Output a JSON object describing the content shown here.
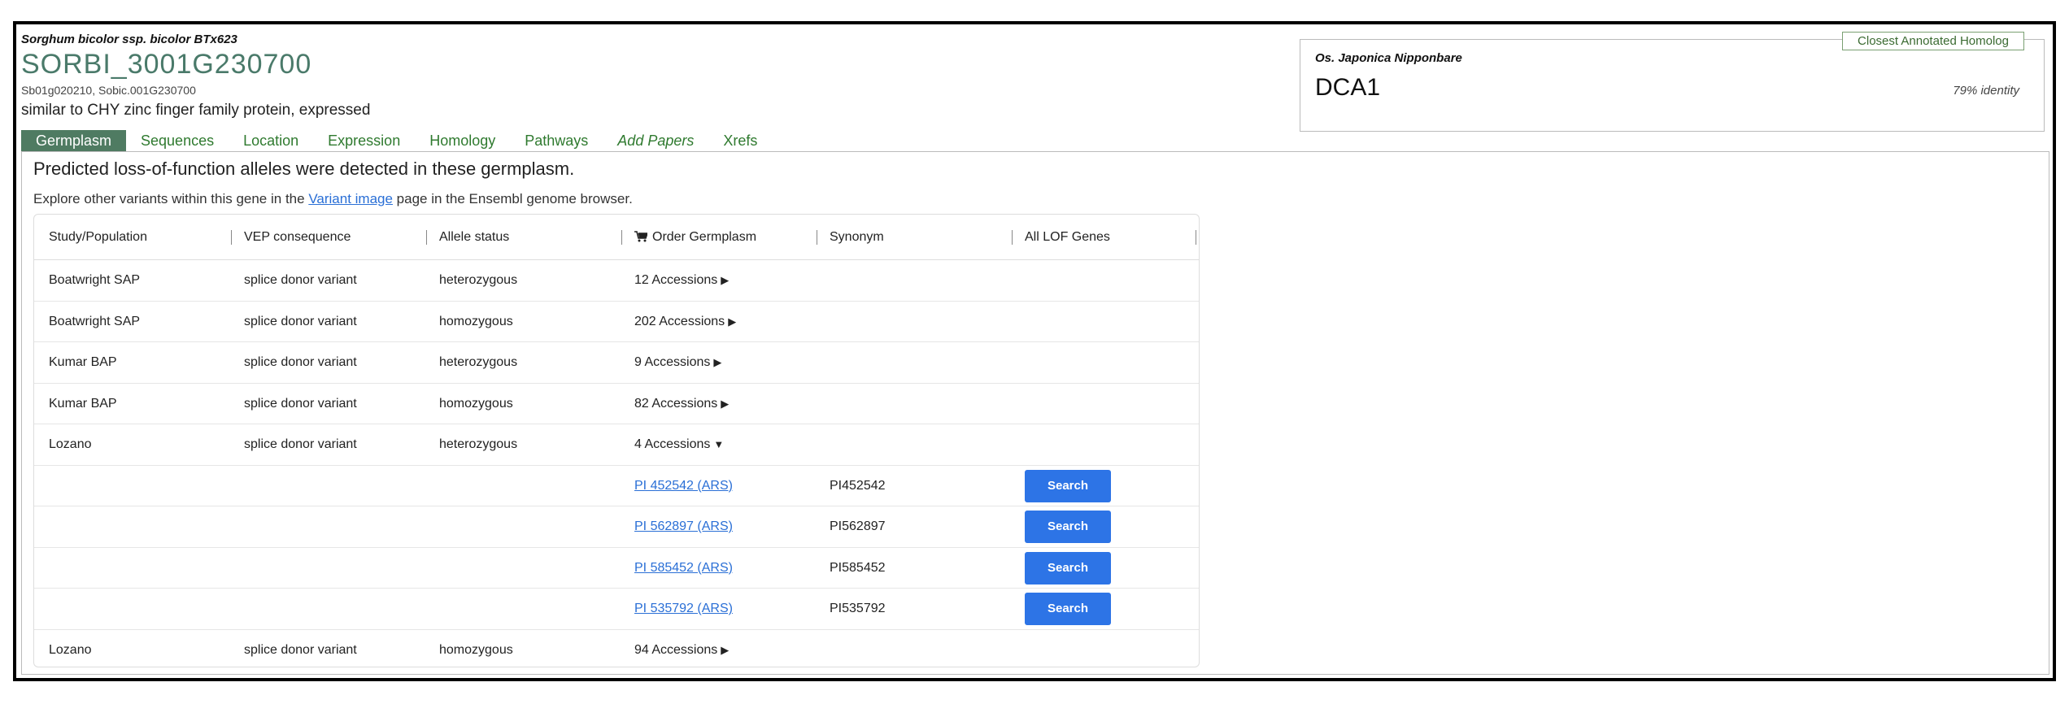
{
  "gene": {
    "species": "Sorghum bicolor ssp. bicolor BTx623",
    "id": "SORBI_3001G230700",
    "synonyms": "Sb01g020210, Sobic.001G230700",
    "description": "similar to CHY zinc finger family protein, expressed"
  },
  "homolog": {
    "tag": "Closest Annotated Homolog",
    "species": "Os. Japonica Nipponbare",
    "gene": "DCA1",
    "identity": "79% identity"
  },
  "tabs": [
    {
      "label": "Germplasm",
      "active": true
    },
    {
      "label": "Sequences"
    },
    {
      "label": "Location"
    },
    {
      "label": "Expression"
    },
    {
      "label": "Homology"
    },
    {
      "label": "Pathways"
    },
    {
      "label": "Add Papers",
      "italic": true
    },
    {
      "label": "Xrefs"
    }
  ],
  "panel": {
    "lead": "Predicted loss-of-function alleles were detected in these germplasm.",
    "explore_prefix": "Explore other variants within this gene in the ",
    "explore_link": "Variant image",
    "explore_suffix": " page in the Ensembl genome browser."
  },
  "table": {
    "headers": [
      "Study/Population",
      "VEP consequence",
      "Allele status",
      "Order Germplasm",
      "Synonym",
      "All LOF Genes"
    ],
    "button_label": "Search",
    "rows": [
      {
        "study": "Boatwright SAP",
        "vep": "splice donor variant",
        "allele": "heterozygous",
        "order": "12 Accessions",
        "arrow": "▶"
      },
      {
        "study": "Boatwright SAP",
        "vep": "splice donor variant",
        "allele": "homozygous",
        "order": "202 Accessions",
        "arrow": "▶"
      },
      {
        "study": "Kumar BAP",
        "vep": "splice donor variant",
        "allele": "heterozygous",
        "order": "9 Accessions",
        "arrow": "▶"
      },
      {
        "study": "Kumar BAP",
        "vep": "splice donor variant",
        "allele": "homozygous",
        "order": "82 Accessions",
        "arrow": "▶"
      },
      {
        "study": "Lozano",
        "vep": "splice donor variant",
        "allele": "heterozygous",
        "order": "4 Accessions",
        "arrow": "▼"
      }
    ],
    "accessions": [
      {
        "link": "PI 452542 (ARS)",
        "synonym": "PI452542"
      },
      {
        "link": "PI 562897 (ARS)",
        "synonym": "PI562897"
      },
      {
        "link": "PI 585452 (ARS)",
        "synonym": "PI585452"
      },
      {
        "link": "PI 535792 (ARS)",
        "synonym": "PI535792"
      }
    ],
    "last_row": {
      "study": "Lozano",
      "vep": "splice donor variant",
      "allele": "homozygous",
      "order": "94 Accessions",
      "arrow": "▶"
    }
  }
}
